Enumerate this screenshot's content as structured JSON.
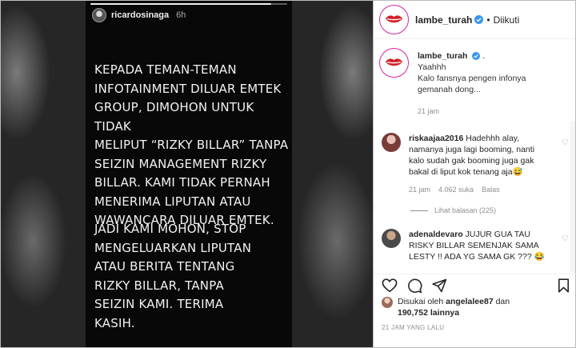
{
  "story": {
    "username": "ricardosinaga",
    "time": "6h",
    "progress_fraction": 0.92,
    "paragraph1": "KEPADA TEMAN-TEMAN\nINFOTAINMENT DILUAR EMTEK\nGROUP, DIMOHON UNTUK TIDAK\nMELIPUT “RIZKY BILLAR” TANPA\nSEIZIN MANAGEMENT RIZKY\nBILLAR. KAMI TIDAK PERNAH\nMENERIMA LIPUTAN ATAU\nWAWANCARA DILUAR EMTEK.",
    "paragraph2": "JADI KAMI MOHON, STOP\nMENGELUARKAN LIPUTAN\nATAU BERITA TENTANG\nRIZKY BILLAR, TANPA\nSEIZIN KAMI. TERIMA\nKASIH."
  },
  "post": {
    "header": {
      "username": "lambe_turah",
      "separator": "•",
      "follow_state": "Diikuti"
    },
    "caption": {
      "username": "lambe_turah",
      "suffix": " .",
      "text": "Yaahhh\nKalo fansnya pengen infonya gemanah dong...",
      "time": "21 jam"
    },
    "comments": [
      {
        "username": "riskaajaa2016",
        "text": " Hadehhh alay, namanya juga lagi booming, nanti kalo sudah gak booming juga gak bakal di liput kok tenang aja😅",
        "time": "21 jam",
        "likes": "4.062 suka",
        "reply": "Balas",
        "view_replies": "Lihat balasan (225)"
      },
      {
        "username": "adenaldevaro",
        "text": " JUJUR GUA TAU RISKY BILLAR SEMENJAK SAMA LESTY !! ADA YG SAMA GK ??? 😂"
      }
    ],
    "likes": {
      "prefix": "Disukai oleh ",
      "user": "angelalee87",
      "connector": " dan",
      "count": "190,752",
      "suffix": " lainnya"
    },
    "posted": "21 JAM YANG LALU"
  },
  "colors": {
    "verified": "#3897f0",
    "story_bg": "#080808",
    "lips": "#d42027",
    "ring": "#d6249f"
  }
}
